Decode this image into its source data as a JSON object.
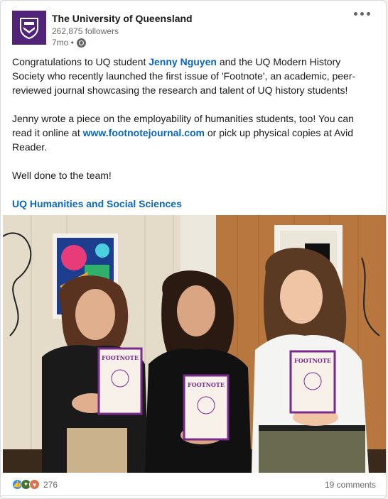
{
  "post": {
    "org_name": "The University of Queensland",
    "followers": "262,875 followers",
    "time": "7mo •",
    "visibility_icon": "globe-icon",
    "more_icon": "more-options-icon",
    "para1_a": "Congratulations to UQ student ",
    "para1_mention": "Jenny Nguyen",
    "para1_b": " and the UQ Modern History Society who recently launched the first issue of 'Footnote', an academic, peer-reviewed journal showcasing the research and talent of UQ history students!",
    "para2_a": "Jenny wrote a piece on the employability of humanities students, too! You can read it online at ",
    "para2_link": "www.footnotejournal.com",
    "para2_b": " or pick up physical copies at Avid Reader.",
    "para3": "Well done to the team!",
    "hashtag": "UQ Humanities and Social Sciences",
    "journal_title": "FOOTNOTE"
  },
  "social": {
    "reaction_icons": [
      "like-icon",
      "celebrate-icon",
      "love-icon"
    ],
    "reaction_count": "276",
    "comments": "19 comments"
  },
  "colors": {
    "brand": "#51247a",
    "link": "#0a66c2"
  }
}
